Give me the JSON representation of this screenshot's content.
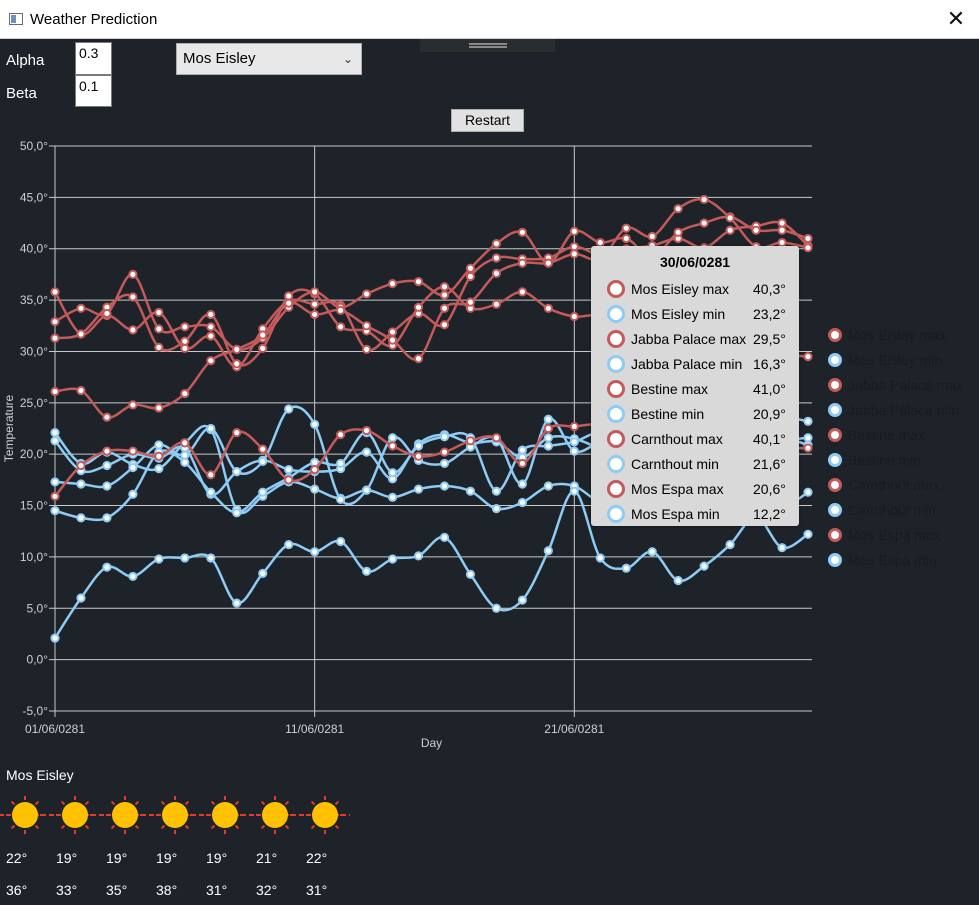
{
  "window": {
    "title": "Weather Prediction"
  },
  "controls": {
    "alpha_label": "Alpha",
    "alpha_value": "0.3",
    "beta_label": "Beta",
    "beta_value": "0.1",
    "city_selected": "Mos Eisley",
    "restart_label": "Restart"
  },
  "colors": {
    "max": "#c45a5a",
    "min": "#8ecbf5",
    "background": "#1d2329"
  },
  "chart_data": {
    "type": "line",
    "xlabel": "Day",
    "ylabel": "Temperature",
    "ylim": [
      -5,
      50
    ],
    "yticks": [
      "-5,0°",
      "0,0°",
      "5,0°",
      "10,0°",
      "15,0°",
      "20,0°",
      "25,0°",
      "30,0°",
      "35,0°",
      "40,0°",
      "45,0°",
      "50,0°"
    ],
    "xtick_labels": [
      "01/06/0281",
      "11/06/0281",
      "21/06/0281"
    ],
    "x": [
      1,
      2,
      3,
      4,
      5,
      6,
      7,
      8,
      9,
      10,
      11,
      12,
      13,
      14,
      15,
      16,
      17,
      18,
      19,
      20,
      21,
      22,
      23,
      24,
      25,
      26,
      27,
      28,
      29,
      30
    ],
    "grid": true,
    "legend_position": "right",
    "series": [
      {
        "name": "Mos Eisley max",
        "kind": "max",
        "values": [
          35.8,
          31.7,
          33.5,
          32.1,
          33.8,
          30.3,
          31.5,
          28.5,
          32.2,
          34.9,
          34.6,
          34.5,
          30.2,
          31.9,
          33.7,
          32.6,
          37.3,
          39.1,
          39.0,
          39.1,
          40.2,
          39.4,
          40.0,
          40.3,
          41.0,
          40.1,
          41.8,
          42.2,
          42.5,
          40.3
        ]
      },
      {
        "name": "Mos Eisley min",
        "kind": "min",
        "values": [
          21.3,
          18.4,
          18.9,
          20.0,
          19.6,
          20.6,
          16.1,
          18.3,
          19.4,
          18.5,
          18.3,
          18.6,
          20.2,
          17.6,
          21.0,
          21.9,
          21.1,
          21.2,
          19.7,
          21.6,
          21.5,
          20.5,
          19.3,
          21.0,
          22.2,
          22.5,
          21.7,
          22.2,
          23.5,
          23.2
        ]
      },
      {
        "name": "Jabba Palace max",
        "kind": "max",
        "values": [
          31.3,
          31.7,
          34.3,
          35.3,
          30.4,
          31.0,
          33.6,
          28.8,
          30.3,
          35.4,
          35.6,
          32.4,
          32.0,
          30.6,
          34.3,
          36.3,
          34.2,
          34.6,
          35.8,
          34.2,
          33.4,
          33.5,
          32.1,
          31.5,
          30.8,
          30.5,
          30.8,
          30.0,
          29.7,
          29.5
        ]
      },
      {
        "name": "Jabba Palace min",
        "kind": "min",
        "values": [
          22.1,
          19.1,
          20.2,
          19.0,
          18.6,
          21.1,
          22.4,
          14.6,
          15.9,
          17.3,
          16.6,
          15.7,
          16.5,
          15.8,
          16.6,
          16.9,
          16.4,
          14.7,
          15.3,
          16.9,
          16.9,
          15.4,
          16.0,
          15.8,
          16.4,
          14.1,
          14.5,
          13.7,
          14.6,
          16.3
        ]
      },
      {
        "name": "Bestine max",
        "kind": "max",
        "values": [
          32.9,
          34.2,
          33.7,
          37.5,
          32.2,
          32.4,
          32.4,
          30.2,
          31.3,
          34.3,
          35.8,
          34.3,
          35.6,
          36.6,
          36.8,
          35.5,
          38.1,
          40.5,
          41.6,
          38.6,
          41.7,
          40.6,
          41.0,
          39.2,
          41.6,
          42.5,
          43.1,
          41.8,
          41.8,
          41.0
        ]
      },
      {
        "name": "Bestine min",
        "kind": "min",
        "values": [
          17.3,
          17.1,
          16.9,
          18.7,
          20.9,
          19.9,
          22.5,
          18.3,
          19.3,
          24.4,
          22.9,
          15.6,
          16.5,
          21.6,
          19.4,
          19.1,
          20.7,
          21.5,
          17.1,
          23.4,
          20.3,
          21.1,
          20.7,
          21.5,
          22.6,
          22.5,
          22.1,
          22.3,
          21.7,
          20.9
        ]
      },
      {
        "name": "Carnthout max",
        "kind": "max",
        "values": [
          26.1,
          26.2,
          23.6,
          24.8,
          24.5,
          25.9,
          29.1,
          30.2,
          31.6,
          34.7,
          33.6,
          34.0,
          32.5,
          31.1,
          29.3,
          34.2,
          34.8,
          37.6,
          38.6,
          38.6,
          39.5,
          39.0,
          42.0,
          41.2,
          43.9,
          44.8,
          43.0,
          40.2,
          40.6,
          40.1
        ]
      },
      {
        "name": "Carnthout min",
        "kind": "min",
        "values": [
          14.5,
          13.8,
          13.8,
          16.1,
          20.2,
          19.2,
          16.3,
          14.3,
          16.3,
          17.7,
          19.2,
          19.1,
          22.1,
          18.2,
          20.8,
          21.7,
          21.6,
          16.4,
          20.4,
          20.8,
          21.2,
          22.0,
          19.7,
          20.2,
          21.0,
          20.2,
          21.5,
          20.8,
          21.3,
          21.6
        ]
      },
      {
        "name": "Mos Espa max",
        "kind": "max",
        "values": [
          15.9,
          18.9,
          20.3,
          20.3,
          19.8,
          21.1,
          18.0,
          22.1,
          20.5,
          17.5,
          18.5,
          21.9,
          22.3,
          20.8,
          19.8,
          20.2,
          21.3,
          21.6,
          19.1,
          22.5,
          22.7,
          22.9,
          22.1,
          21.8,
          22.1,
          21.6,
          21.0,
          20.9,
          20.6,
          20.6
        ]
      },
      {
        "name": "Mos Espa min",
        "kind": "min",
        "values": [
          2.1,
          6.0,
          9.0,
          8.1,
          9.8,
          9.9,
          9.9,
          5.5,
          8.4,
          11.2,
          10.5,
          11.5,
          8.6,
          9.8,
          10.1,
          11.9,
          8.3,
          5.0,
          5.8,
          10.6,
          16.4,
          9.9,
          8.9,
          10.5,
          7.7,
          9.1,
          11.2,
          13.9,
          10.9,
          12.2
        ]
      }
    ]
  },
  "tooltip": {
    "date": "30/06/0281",
    "rows": [
      {
        "name": "Mos Eisley max",
        "value": "40,3°",
        "kind": "max"
      },
      {
        "name": "Mos Eisley min",
        "value": "23,2°",
        "kind": "min"
      },
      {
        "name": "Jabba Palace max",
        "value": "29,5°",
        "kind": "max"
      },
      {
        "name": "Jabba Palace min",
        "value": "16,3°",
        "kind": "min"
      },
      {
        "name": "Bestine max",
        "value": "41,0°",
        "kind": "max"
      },
      {
        "name": "Bestine min",
        "value": "20,9°",
        "kind": "min"
      },
      {
        "name": "Carnthout max",
        "value": "40,1°",
        "kind": "max"
      },
      {
        "name": "Carnthout min",
        "value": "21,6°",
        "kind": "min"
      },
      {
        "name": "Mos Espa max",
        "value": "20,6°",
        "kind": "max"
      },
      {
        "name": "Mos Espa min",
        "value": "12,2°",
        "kind": "min"
      }
    ]
  },
  "forecast": {
    "city": "Mos Eisley",
    "icon": "sun-icon",
    "days": [
      {
        "min": "22°",
        "max": "36°"
      },
      {
        "min": "19°",
        "max": "33°"
      },
      {
        "min": "19°",
        "max": "35°"
      },
      {
        "min": "19°",
        "max": "38°"
      },
      {
        "min": "19°",
        "max": "31°"
      },
      {
        "min": "21°",
        "max": "32°"
      },
      {
        "min": "22°",
        "max": "31°"
      }
    ]
  }
}
